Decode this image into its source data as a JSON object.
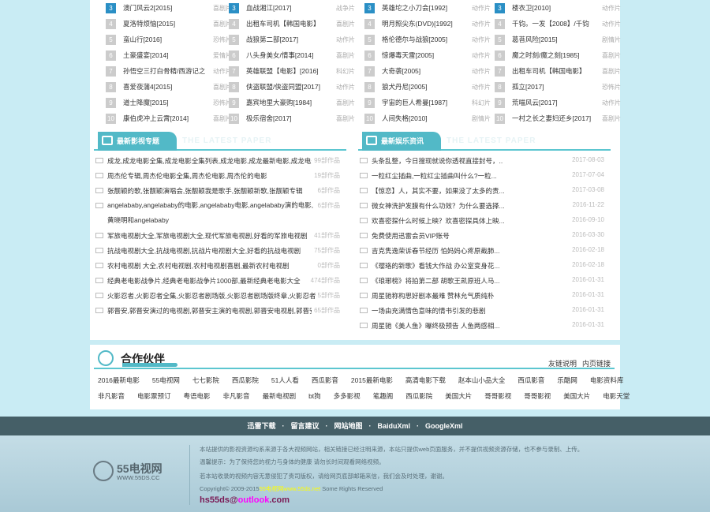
{
  "ranks": [
    [
      {
        "n": "3",
        "t": "澳门风云2[2015]",
        "g": "喜剧片"
      },
      {
        "n": "4",
        "t": "夏洛特烦恼[2015]",
        "g": "喜剧片"
      },
      {
        "n": "5",
        "t": "蛮山行[2016]",
        "g": "恐怖片"
      },
      {
        "n": "6",
        "t": "土豪盛宴[2014]",
        "g": "爱情片"
      },
      {
        "n": "7",
        "t": "孙悟空三打白骨精/西游记之",
        "g": "动作片"
      },
      {
        "n": "8",
        "t": "喜爱夜蒲4[2015]",
        "g": "喜剧片"
      },
      {
        "n": "9",
        "t": "道士降魔[2015]",
        "g": "恐怖片"
      },
      {
        "n": "10",
        "t": "康伯虎冲上云霄[2014]",
        "g": "喜剧片"
      }
    ],
    [
      {
        "n": "3",
        "t": "血战湘江[2017]",
        "g": "战争片"
      },
      {
        "n": "4",
        "t": "出租车司机【韩国电影】",
        "g": "喜剧片"
      },
      {
        "n": "5",
        "t": "战狼第二部[2017]",
        "g": "动作片"
      },
      {
        "n": "6",
        "t": "八头身美女/情事[2014]",
        "g": "喜剧片"
      },
      {
        "n": "7",
        "t": "英雄联盟【电影】[2016]",
        "g": "科幻片"
      },
      {
        "n": "8",
        "t": "侠盗联盟/侠盗同盟[2017]",
        "g": "动作片"
      },
      {
        "n": "9",
        "t": "嘉宾地里大豪购[1984]",
        "g": "喜剧片"
      },
      {
        "n": "10",
        "t": "极乐宿舍[2017]",
        "g": "喜剧片"
      }
    ],
    [
      {
        "n": "3",
        "t": "英雄坨之小刀会[1992]",
        "g": "动作片"
      },
      {
        "n": "4",
        "t": "明月照尖东(DVD)[1992]",
        "g": "动作片"
      },
      {
        "n": "5",
        "t": "格伦德尔与战狼[2005]",
        "g": "动作片"
      },
      {
        "n": "6",
        "t": "惊爆毒天雷[2005]",
        "g": "动作片"
      },
      {
        "n": "7",
        "t": "大奇袭[2005]",
        "g": "动作片"
      },
      {
        "n": "8",
        "t": "狼犬丹尼[2005]",
        "g": "动作片"
      },
      {
        "n": "9",
        "t": "宇宙的巨人希曼[1987]",
        "g": "科幻片"
      },
      {
        "n": "10",
        "t": "人间失格[2010]",
        "g": "剧情片"
      }
    ],
    [
      {
        "n": "3",
        "t": "楼衣卫[2010]",
        "g": "动作片"
      },
      {
        "n": "4",
        "t": "千钧。一发【2008】/千钧",
        "g": "动作片"
      },
      {
        "n": "5",
        "t": "葛菩风险[2015]",
        "g": "剧情片"
      },
      {
        "n": "6",
        "t": "魔之时刻/魔之刻[1985]",
        "g": "喜剧片"
      },
      {
        "n": "7",
        "t": "出租车司机【韩国电影】",
        "g": "喜剧片"
      },
      {
        "n": "8",
        "t": "孤立[2017]",
        "g": "恐怖片"
      },
      {
        "n": "9",
        "t": "荒喵风云[2017]",
        "g": "动作片"
      },
      {
        "n": "10",
        "t": "一村之长之妻妇还乡[2017]",
        "g": "喜剧片"
      }
    ]
  ],
  "panels": {
    "left": {
      "title": "最新影视专题",
      "en": "THE LATEST PAPER"
    },
    "right": {
      "title": "最新娱乐资讯",
      "en": "THE LATEST PAPER"
    }
  },
  "topics": [
    {
      "t": "成龙,成龙电影全集,成龙电影全集列表,成龙电影,成龙最新电影,成龙电影大全",
      "r": "99部作品"
    },
    {
      "t": "周杰伦专辑,周杰伦电影全集,周杰伦电影,周杰伦的电影",
      "r": "19部作品"
    },
    {
      "t": "张靓颖的歌,张靓颖演唱会,张靓颖我是歌手,张靓颖新歌,张靓颖专辑",
      "r": "6部作品"
    },
    {
      "t": "angelababy,angelababy的电影,angelababy电影,angelababy演的电影,黄晓明和angelababy",
      "r": "6部作品",
      "tall": true
    },
    {
      "t": "军旅电视剧大全,军旅电视剧大全,现代军旅电视剧,好看的军旅电视剧",
      "r": "41部作品"
    },
    {
      "t": "抗战电视剧大全,抗战电视剧,抗战片电视剧大全,好看的抗战电视剧",
      "r": "75部作品"
    },
    {
      "t": "农村电视剧 大全,农村电视剧,农村电视剧喜剧,最新农村电视剧",
      "r": "0部作品"
    },
    {
      "t": "经典老电影战争片,经典老电影战争片1000部,最新经典老电影大全",
      "r": "474部作品"
    },
    {
      "t": "火影忍者,火影忍者全集,火影忍者剧场版,火影忍者剧场版终章,火影忍者下载",
      "r": "5部作品"
    },
    {
      "t": "郭晋安,郭晋安演过的电视剧,郭晋安主演的电视剧,郭晋安电视剧,郭晋安电视剧",
      "r": "65部作品"
    }
  ],
  "news": [
    {
      "t": "头条乱整，今日搜现就说你透视直接封号，..",
      "d": "2017-08-03"
    },
    {
      "t": "一粒红尘插曲,一粒红尘插曲叫什么?一粒...",
      "d": "2017-07-04"
    },
    {
      "t": "【惊恋】人，其实不要，如果没了太多的责...",
      "d": "2017-03-08"
    },
    {
      "t": "微女神洗护发膜有什么功效？为什么要选择...",
      "d": "2016-11-22"
    },
    {
      "t": "欢喜密探什么时候上映？欢喜密探具体上映...",
      "d": "2016-09-10"
    },
    {
      "t": "免费使用迅雷会员VIP账号",
      "d": "2016-03-30"
    },
    {
      "t": "吉克隽逸荣诉春节经历 怕妈妈心疼原截肺...",
      "d": "2016-02-18"
    },
    {
      "t": "《璎珞的新歌》看钱大作战 办公室变身花...",
      "d": "2016-02-18"
    },
    {
      "t": "《琅琊榜》将拍第二部 胡歌王凯原班人马...",
      "d": "2016-01-31"
    },
    {
      "t": "周星驰称构思好剧本最难 赞林允气质纯朴",
      "d": "2016-01-31"
    },
    {
      "t": "一场由充满情色意味的情书引发的悲剧",
      "d": "2016-01-31"
    },
    {
      "t": "周星驰《美人鱼》曝终极预告 人鱼两感相...",
      "d": "2016-01-31"
    }
  ],
  "partner": {
    "title": "合作伙伴",
    "link1": "友链说明",
    "link2": "内页链接",
    "row1": [
      "2016最新电影",
      "55电视网",
      "七七影院",
      "西瓜影院",
      "51人人看",
      "西瓜影音",
      "2015最新电影",
      "高清电影下载",
      "赵本山小品大全",
      "西瓜影音",
      "乐酷网",
      "电影资料库"
    ],
    "row2": [
      "非凡影音",
      "电影票预订",
      "粤语电影",
      "非凡影音",
      "最新电视剧",
      "bt狗",
      "多多影视",
      "笔趣阁",
      "西瓜影院",
      "美国大片",
      "哥哥影视",
      "哥哥影视",
      "美国大片",
      "电影天堂"
    ]
  },
  "nav": [
    "迅雷下载",
    "留言建议",
    "网站地图",
    "BaiduXml",
    "GoogleXml"
  ],
  "nav_sep": "·",
  "footer": {
    "logo": "55电视网",
    "logo_sub": "WWW.55DS.CC",
    "l1": "本站提供的影视资源均系来源于各大视频网站，相关链接已经注明来源，本站只提供web页面服务，并不提供视频资源存储，也不参与录制、上传。",
    "l2": "温馨提示：为了保持您的视力与身体的健康 请勿长时间观看网络视频。",
    "l3": "若本站收录的视频内容无意侵犯了贵司版权，请给网页底部邮箱来信，我们会及时处理，谢谢。",
    "l4a": "Copyright© 2009-2015",
    "l4b": "55电视网www.55ds.net",
    "l4c": " Some Rights Reserved",
    "mail_a": "hs55ds@",
    "mail_b": "outlook",
    ".mail_c": "",
    "mail_c": ".com"
  }
}
